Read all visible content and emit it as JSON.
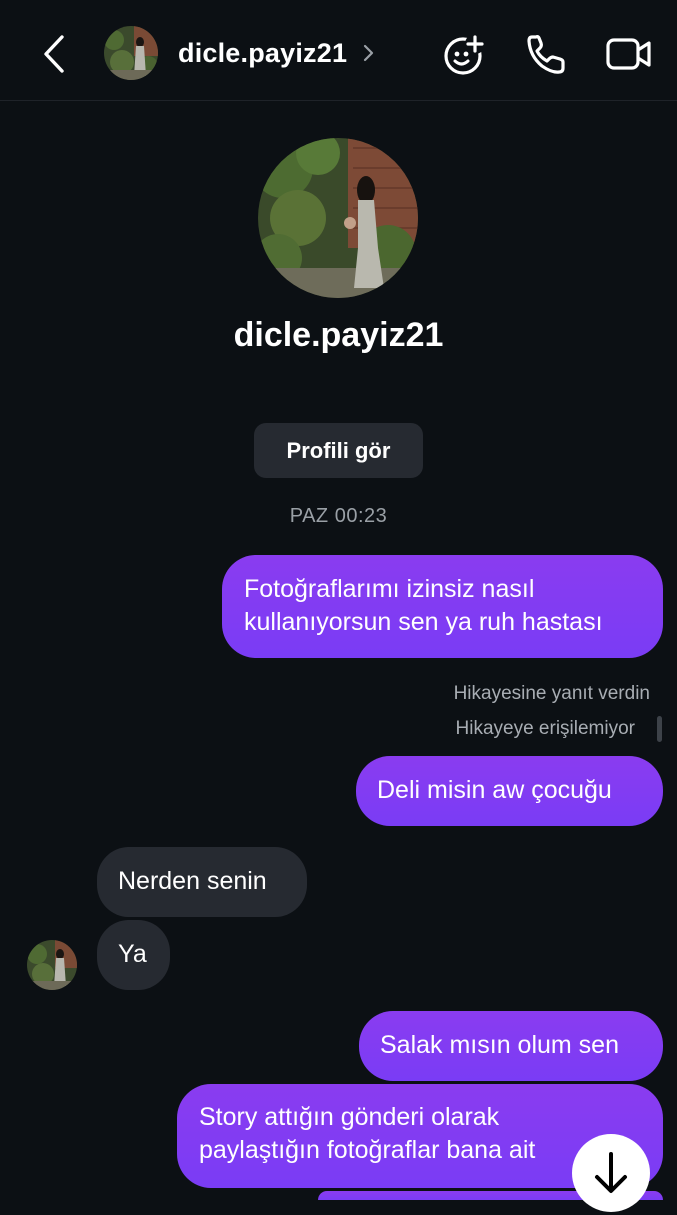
{
  "header": {
    "username": "dicle.payiz21",
    "icons": [
      "back-arrow-icon",
      "chevron-right-icon",
      "sticker-add-icon",
      "phone-icon",
      "video-camera-icon"
    ]
  },
  "profile": {
    "username": "dicle.payiz21",
    "view_profile_label": "Profili gör",
    "timestamp": "PAZ 00:23"
  },
  "messages": {
    "m1_line1": "Fotoğraflarımı izinsiz nasıl",
    "m1_line2": "kullanıyorsun sen ya ruh hastası",
    "note1": "Hikayesine yanıt verdin",
    "note2": "Hikayeye erişilemiyor",
    "m2": "Deli misin aw çocuğu",
    "m3": "Nerden senin",
    "m4": "Ya",
    "m5": "Salak mısın olum sen",
    "m6_line1": "Story attığın gönderi olarak",
    "m6_line2": "paylaştığın fotoğraflar bana ait"
  },
  "colors": {
    "background": "#0c1014",
    "outgoing_bubble": "#8a3cf0",
    "incoming_bubble": "#262a31",
    "secondary_text": "#9aa0a6"
  }
}
